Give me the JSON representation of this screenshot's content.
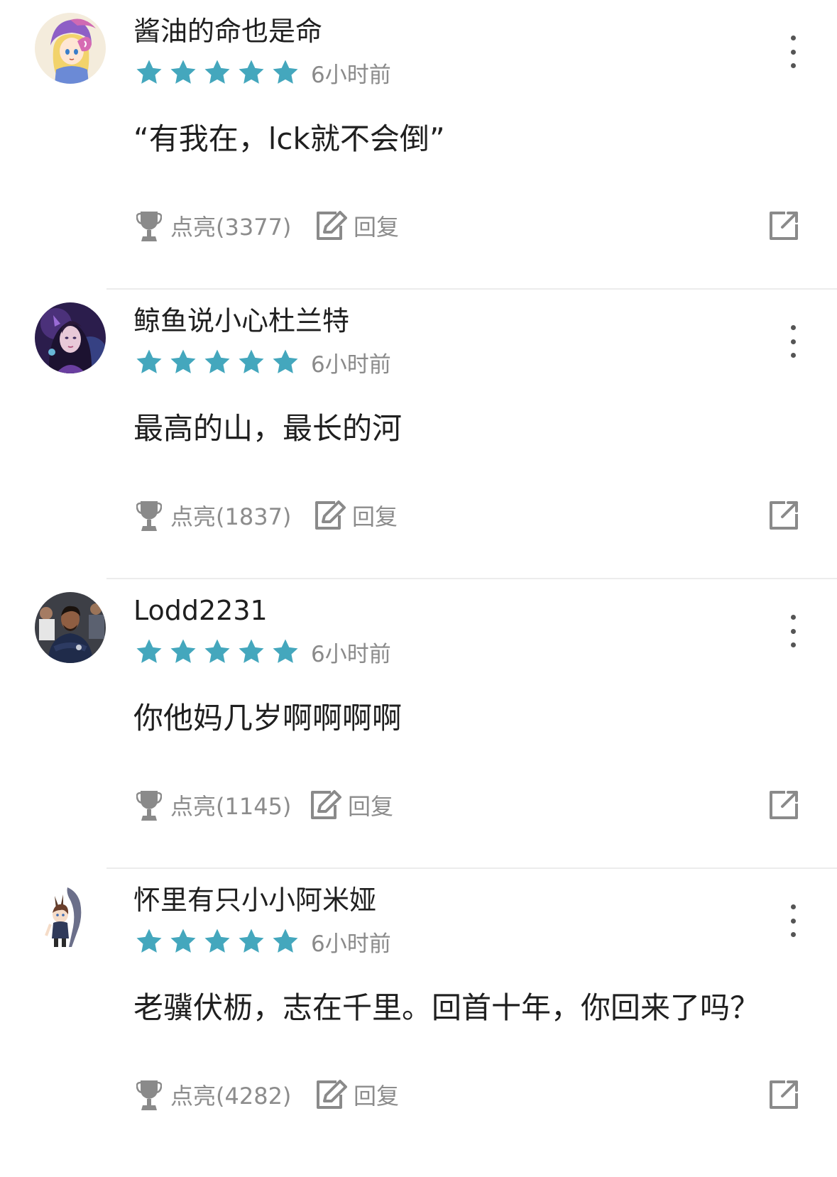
{
  "colors": {
    "star": "#44a7bd",
    "icon_gray": "#8a8a8a",
    "divider": "#ececec"
  },
  "icons": {
    "star": "star-icon",
    "more": "more-vertical-icon",
    "like": "trophy-icon",
    "reply": "edit-icon",
    "share": "share-icon"
  },
  "comments": [
    {
      "username": "酱油的命也是命",
      "stars": 5,
      "time": "6小时前",
      "content": "“有我在，lck就不会倒”",
      "like_label": "点亮(3377)",
      "reply_label": "回复",
      "avatar": "anime-girl-avatar"
    },
    {
      "username": "鲸鱼说小心杜兰特",
      "stars": 5,
      "time": "6小时前",
      "content": "最高的山，最长的河",
      "like_label": "点亮(1837)",
      "reply_label": "回复",
      "avatar": "fantasy-woman-avatar"
    },
    {
      "username": "Lodd2231",
      "stars": 5,
      "time": "6小时前",
      "content": "你他妈几岁啊啊啊啊",
      "like_label": "点亮(1145)",
      "reply_label": "回复",
      "avatar": "man-photo-avatar"
    },
    {
      "username": "怀里有只小小阿米娅",
      "stars": 5,
      "time": "6小时前",
      "content": "老骥伏枥，志在千里。回首十年，你回来了吗？",
      "like_label": "点亮(4282)",
      "reply_label": "回复",
      "avatar": "chibi-character-avatar"
    }
  ]
}
